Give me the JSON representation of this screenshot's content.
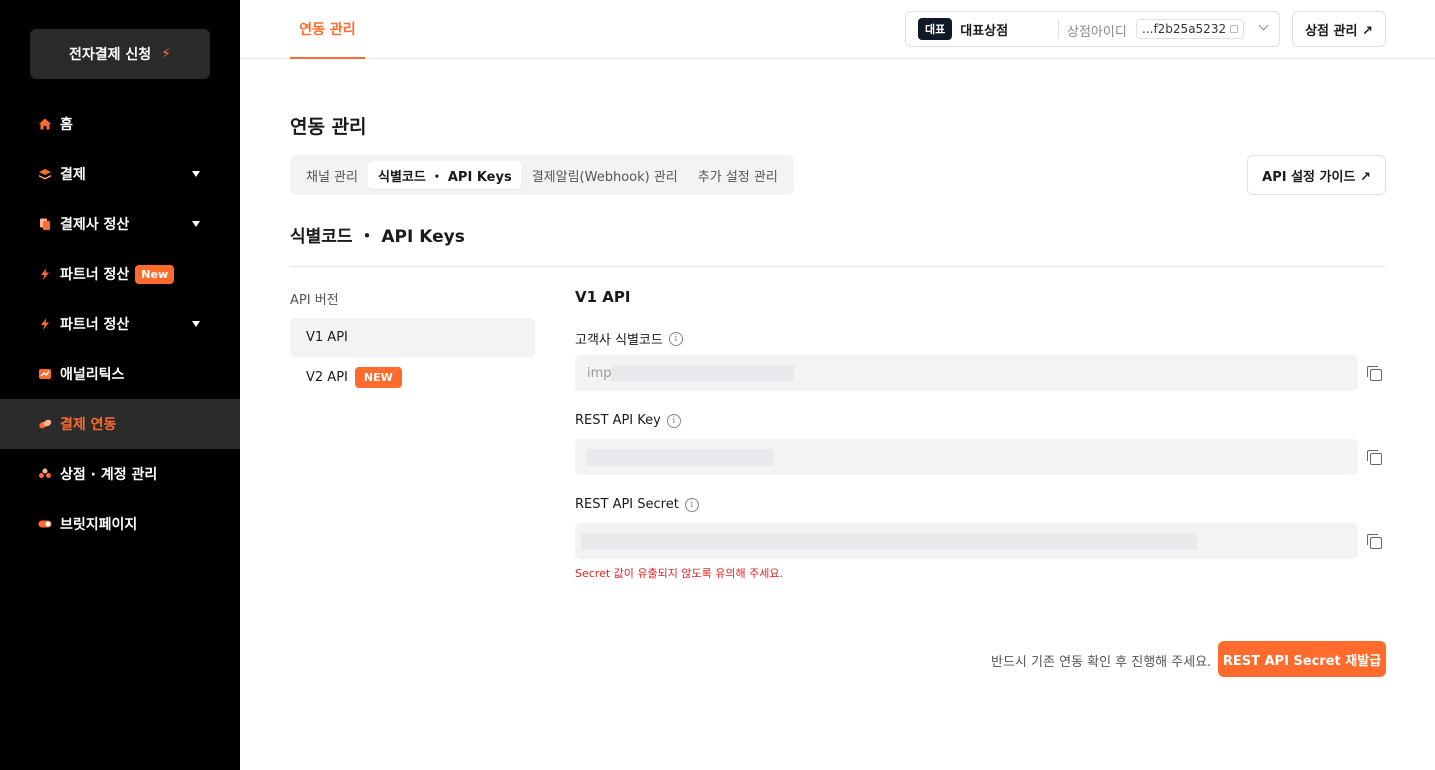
{
  "sidebar": {
    "apply_button": "전자결제 신청",
    "items": [
      {
        "label": "홈",
        "icon": "home-icon"
      },
      {
        "label": "결제",
        "icon": "layers-icon"
      },
      {
        "label": "결제사 정산",
        "icon": "documents-icon"
      },
      {
        "label": "파트너 정산",
        "icon": "bolt-icon",
        "badge": "New"
      },
      {
        "label": "파트너 정산",
        "icon": "bolt-icon"
      },
      {
        "label": "애널리틱스",
        "icon": "chart-icon"
      },
      {
        "label": "결제 연동",
        "icon": "link-icon",
        "active": true
      },
      {
        "label": "상점 · 계정 관리",
        "icon": "users-icon"
      },
      {
        "label": "브릿지페이지",
        "icon": "toggle-icon"
      }
    ]
  },
  "header": {
    "tab": "연동 관리",
    "store": {
      "badge": "대표",
      "name": "대표상점",
      "id_label": "상점아이디",
      "id_value": "...f2b25a5232"
    },
    "store_mgmt_button": "상점 관리 ↗"
  },
  "main": {
    "title": "연동 관리",
    "tabs": [
      {
        "label": "채널 관리"
      },
      {
        "label": "식별코드 ・ API Keys",
        "active": true
      },
      {
        "label": "결제알림(Webhook) 관리"
      },
      {
        "label": "추가 설정 관리"
      }
    ],
    "guide_button": "API 설정 가이드 ↗",
    "section_title": "식별코드 ・ API Keys",
    "version_label": "API 버전",
    "versions": [
      {
        "label": "V1 API",
        "active": true
      },
      {
        "label": "V2 API",
        "badge": "NEW"
      }
    ],
    "api_title": "V1 API",
    "fields": [
      {
        "label": "고객사 식별코드",
        "value": "imp"
      },
      {
        "label": "REST API Key",
        "value": ""
      },
      {
        "label": "REST API Secret",
        "value": ""
      }
    ],
    "warning": "Secret 값이 유출되지 않도록 유의해 주세요.",
    "bottom_note": "반드시 기존 연동 확인 후 진행해 주세요.",
    "reissue_button": "REST API Secret 재발급"
  },
  "colors": {
    "accent": "#ff6b2c",
    "sidebar_bg": "#000000",
    "warning": "#e02424"
  }
}
